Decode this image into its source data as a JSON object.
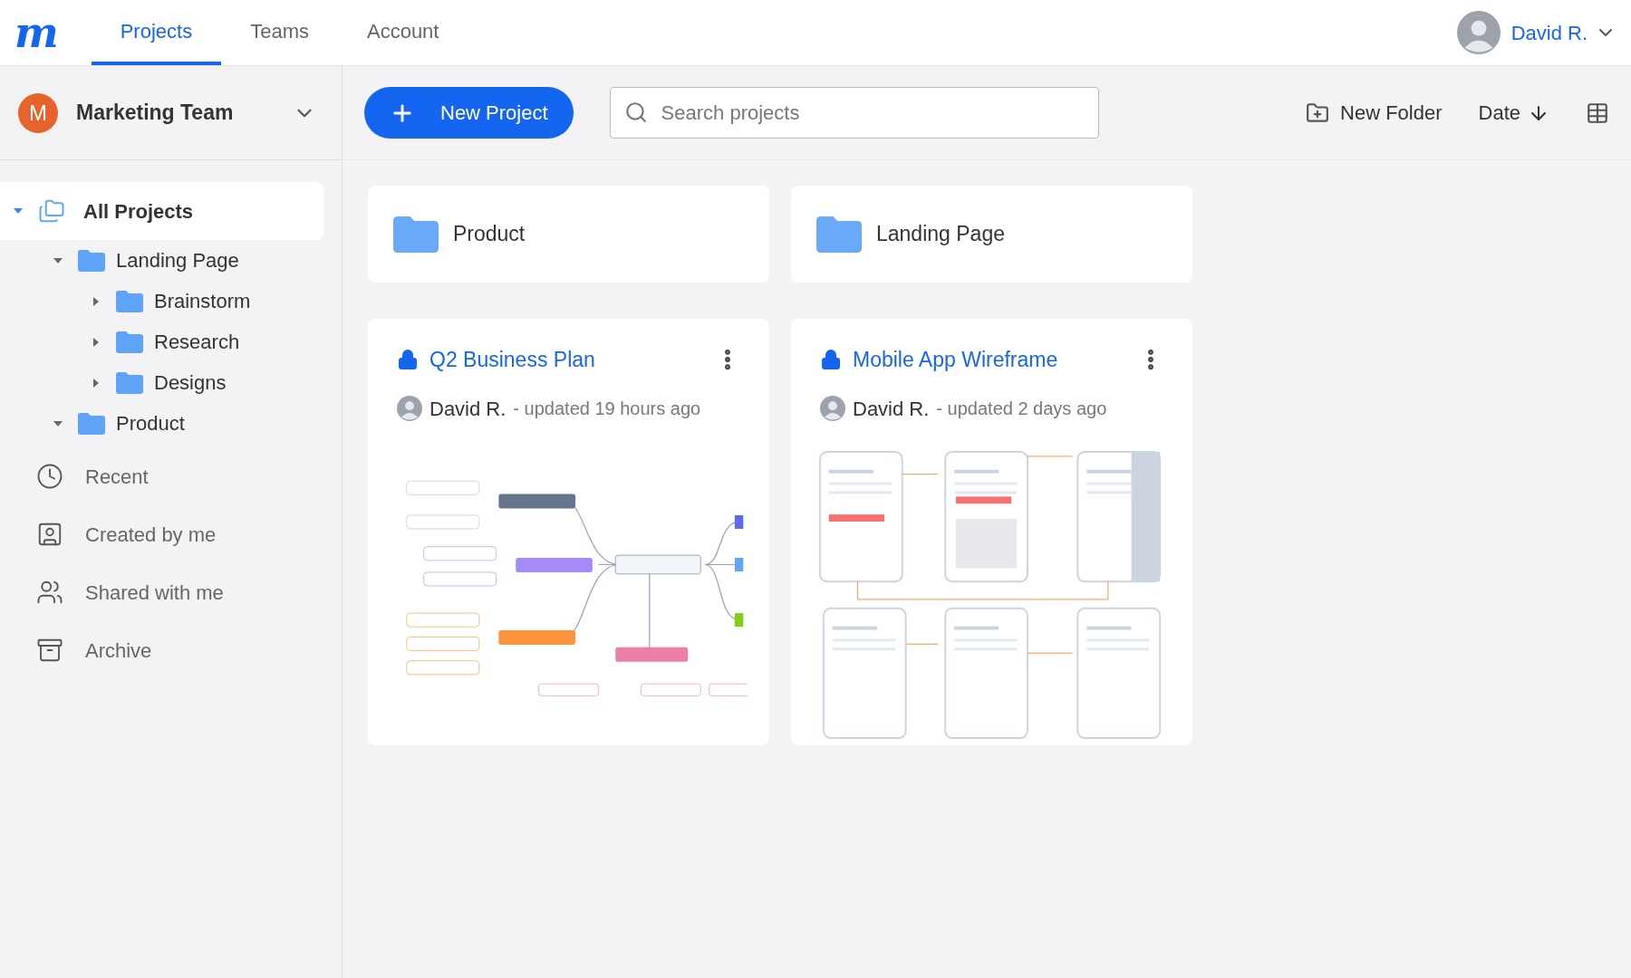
{
  "logo": "m",
  "tabs": [
    {
      "label": "Projects",
      "selected": true
    },
    {
      "label": "Teams",
      "selected": false
    },
    {
      "label": "Account",
      "selected": false
    }
  ],
  "user": {
    "name": "David R."
  },
  "team": {
    "initial": "M",
    "name": "Marketing Team"
  },
  "toolbar": {
    "new_project": "New Project",
    "search": {
      "placeholder": "Search projects"
    },
    "new_folder": "New Folder",
    "sort": "Date"
  },
  "tree": [
    {
      "label": "All Projects",
      "selected": true,
      "expanded": true,
      "children": [
        {
          "label": "Landing Page",
          "selected": false,
          "expanded": true,
          "children": [
            {
              "label": "Brainstorm",
              "selected": false,
              "expanded": false
            },
            {
              "label": "Research",
              "selected": false,
              "expanded": false
            },
            {
              "label": "Designs",
              "selected": false,
              "expanded": false
            }
          ]
        },
        {
          "label": "Product",
          "selected": false,
          "expanded": true
        }
      ]
    }
  ],
  "nav": [
    {
      "kind": "recent",
      "label": "Recent"
    },
    {
      "kind": "created",
      "label": "Created by me"
    },
    {
      "kind": "shared",
      "label": "Shared with me"
    },
    {
      "kind": "archive",
      "label": "Archive"
    }
  ],
  "folders": [
    {
      "name": "Product"
    },
    {
      "name": "Landing Page"
    }
  ],
  "projects": [
    {
      "title": "Q2 Business Plan",
      "locked": true,
      "author": "David R.",
      "updated": "- updated 19 hours ago",
      "kind": "mindmap"
    },
    {
      "title": "Mobile App Wireframe",
      "locked": true,
      "author": "David R.",
      "updated": "- updated 2 days ago",
      "kind": "wireframe"
    }
  ]
}
